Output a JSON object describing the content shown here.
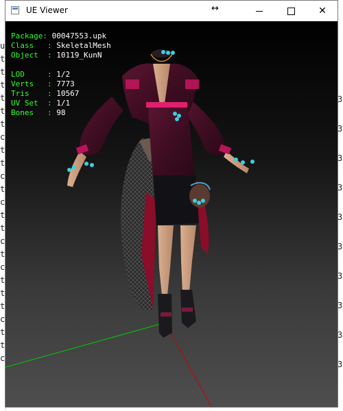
{
  "window": {
    "title": "UE Viewer",
    "resize_icon": "resize-arrows-icon",
    "controls": [
      "minimize",
      "maximize",
      "close"
    ],
    "close_glyph": "✕"
  },
  "info": {
    "package_label": "Package: ",
    "package_value": "00047553.upk",
    "class_label": "Class   : ",
    "class_value": "SkeletalMesh",
    "object_label": "Object  : ",
    "object_value": "10119_KunN",
    "lod_label": "LOD     : ",
    "lod_value": "1/2",
    "verts_label": "Verts   : ",
    "verts_value": "7773",
    "tris_label": "Tris    : ",
    "tris_value": "10567",
    "uvset_label": "UV Set  : ",
    "uvset_value": "1/1",
    "bones_label": "Bones   : ",
    "bones_value": "98"
  },
  "background_window": {
    "left_glyphs": [
      "u",
      "t",
      "t",
      "t",
      "t",
      "t",
      "t",
      "c",
      "t",
      "t",
      "c",
      "t",
      "c",
      "t",
      "t",
      "c",
      "t",
      "c",
      "t",
      "t",
      "t",
      "c",
      "t",
      "t",
      "c"
    ],
    "right_glyphs": [
      "3",
      "3",
      "3",
      "3",
      "3",
      "3",
      "3",
      "3",
      "3",
      "3"
    ]
  },
  "colors": {
    "info_label": "#33ff33",
    "info_value": "#ffffff",
    "axis_x": "#cc0000",
    "axis_y": "#00cc00",
    "axis_z": "#0000dd"
  }
}
